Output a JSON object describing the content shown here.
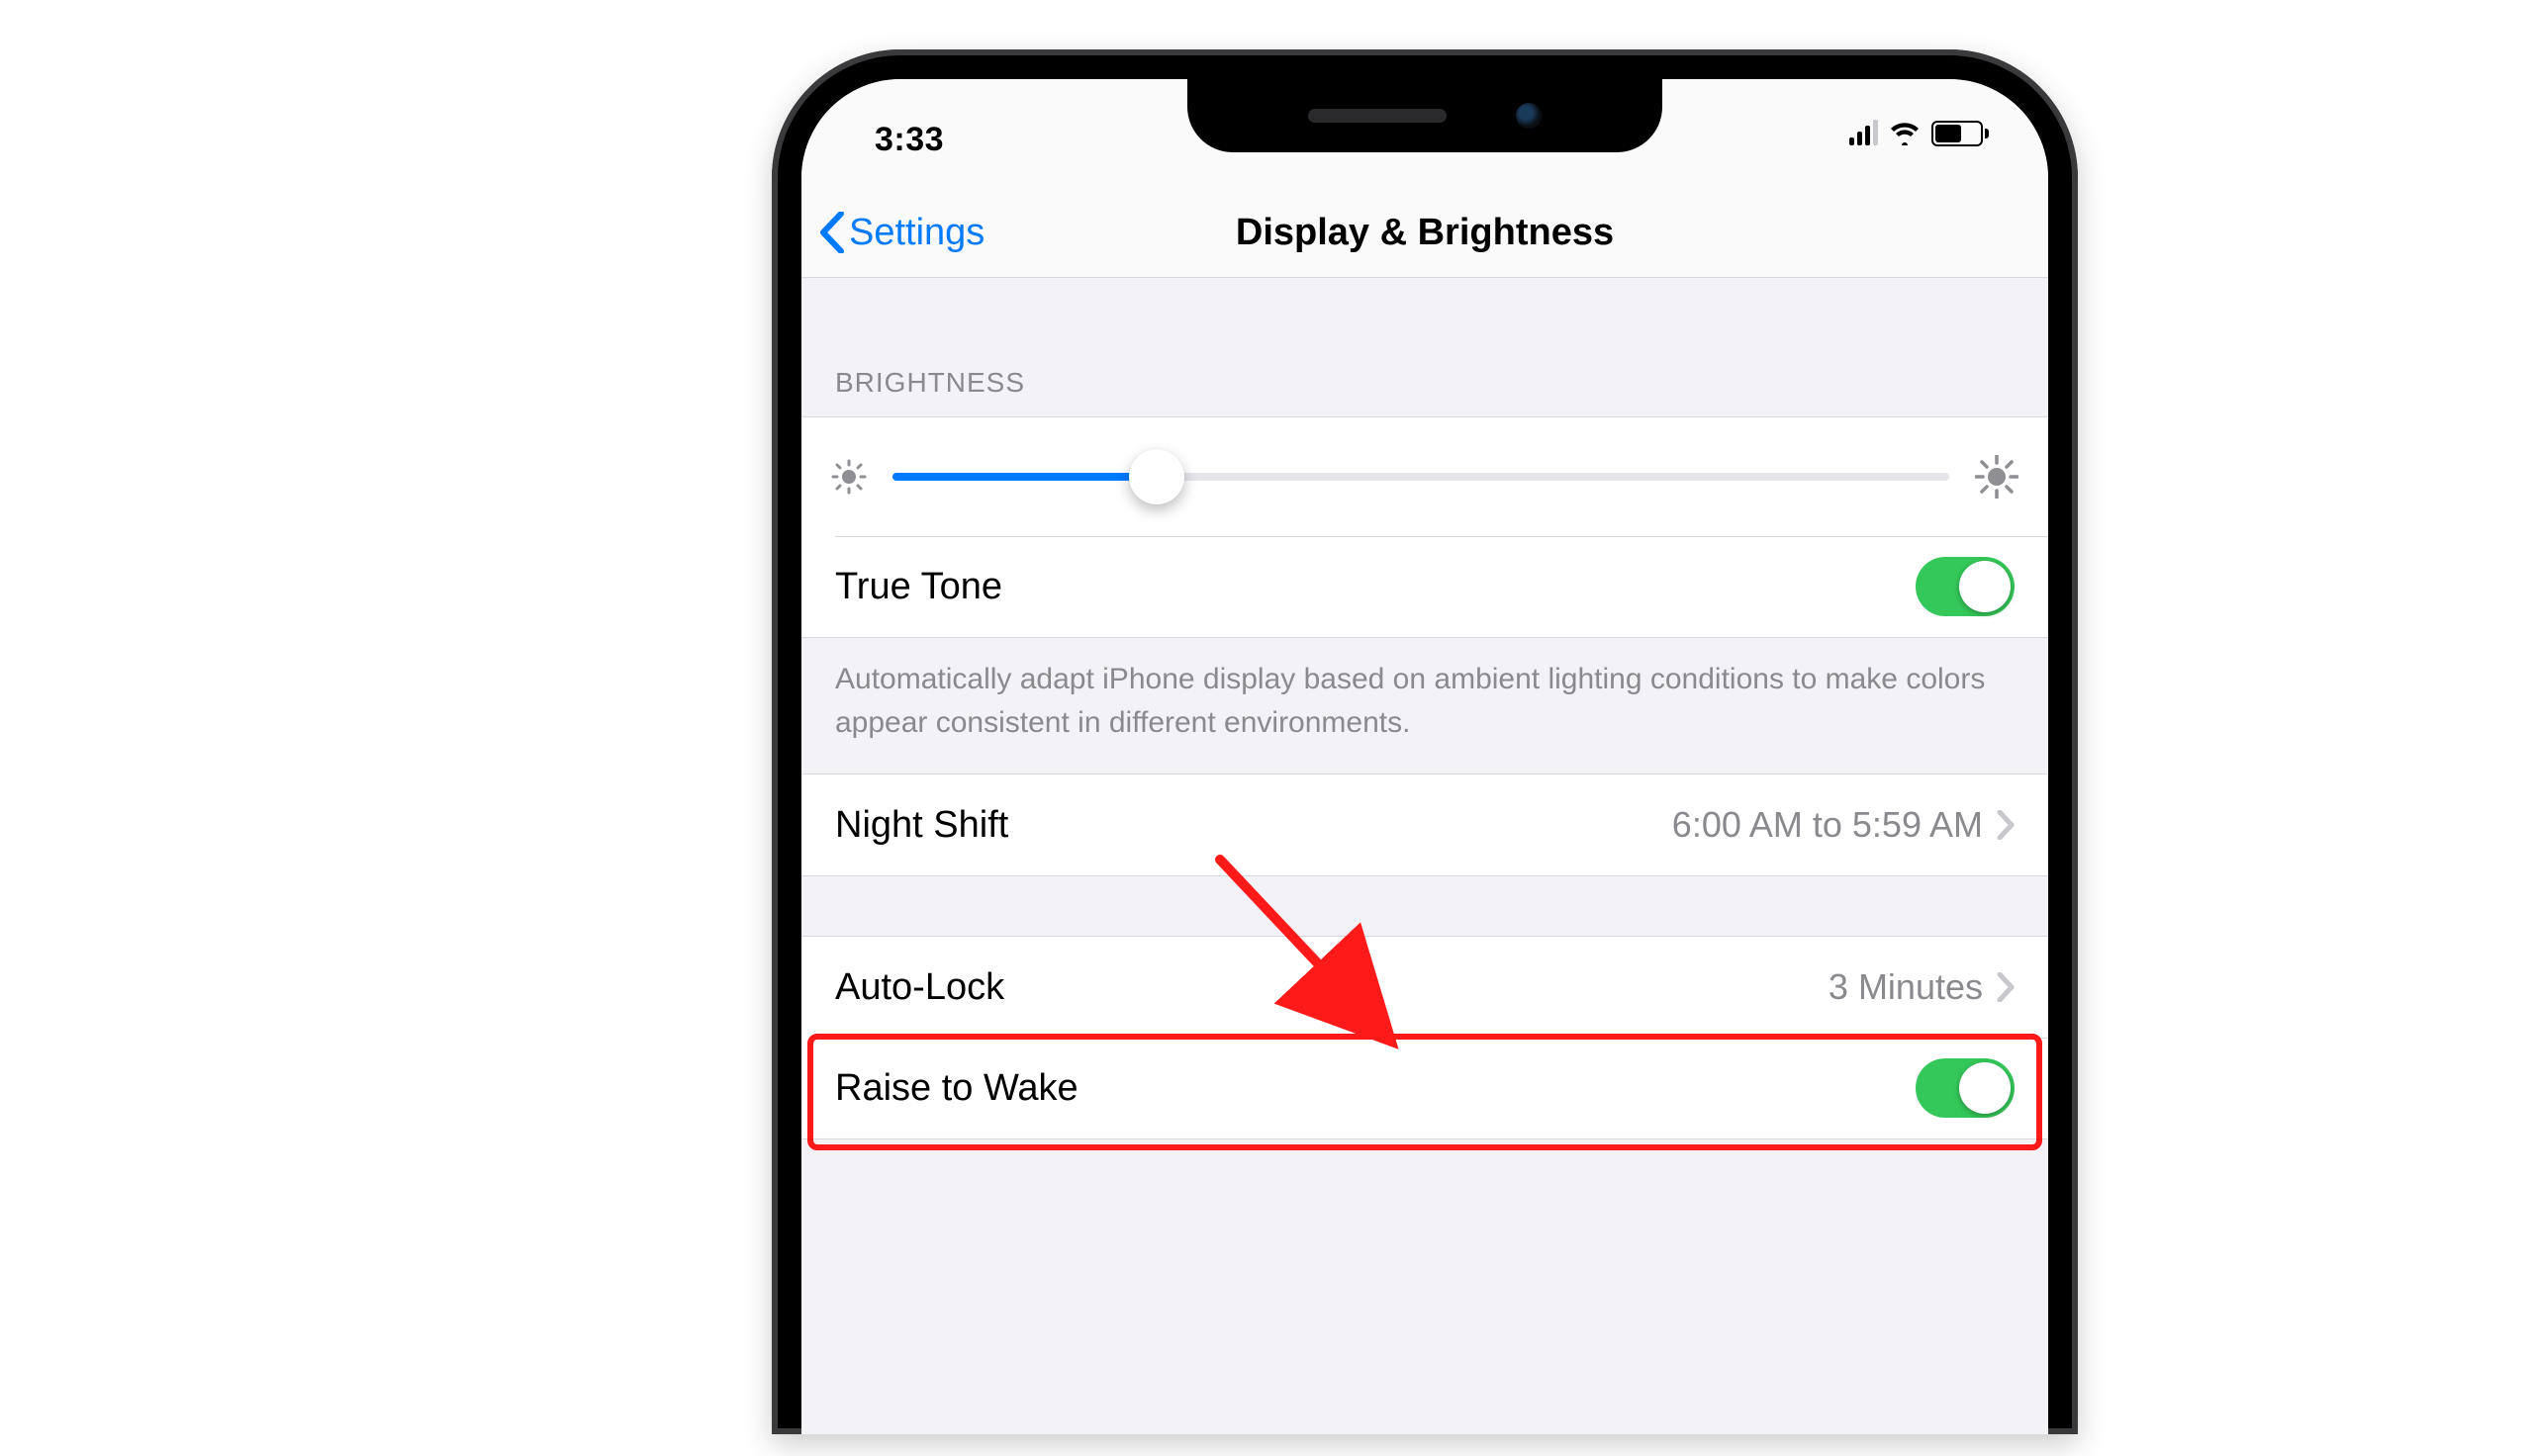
{
  "status": {
    "time": "3:33"
  },
  "nav": {
    "back_label": "Settings",
    "title": "Display & Brightness"
  },
  "sections": {
    "brightness_header": "BRIGHTNESS",
    "brightness_value_percent": 25,
    "truetone_label": "True Tone",
    "truetone_on": true,
    "truetone_footer": "Automatically adapt iPhone display based on ambient lighting conditions to make colors appear consistent in different environments.",
    "nightshift_label": "Night Shift",
    "nightshift_value": "6:00 AM to 5:59 AM",
    "autolock_label": "Auto-Lock",
    "autolock_value": "3 Minutes",
    "raise_label": "Raise to Wake",
    "raise_on": true
  },
  "annotation": {
    "highlight_target": "raise-to-wake-row"
  }
}
